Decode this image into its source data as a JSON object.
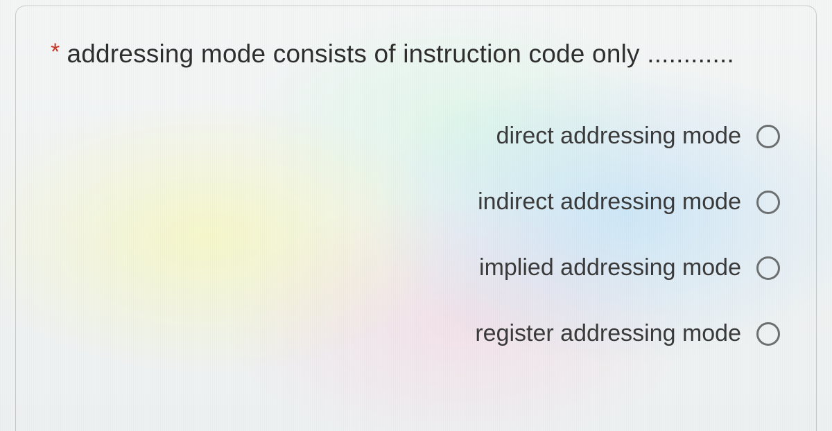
{
  "question": {
    "required_mark": "*",
    "text": "addressing mode consists of instruction code only ............"
  },
  "options": [
    {
      "label": "direct addressing mode"
    },
    {
      "label": "indirect addressing mode"
    },
    {
      "label": "implied addressing mode"
    },
    {
      "label": "register addressing mode"
    }
  ]
}
